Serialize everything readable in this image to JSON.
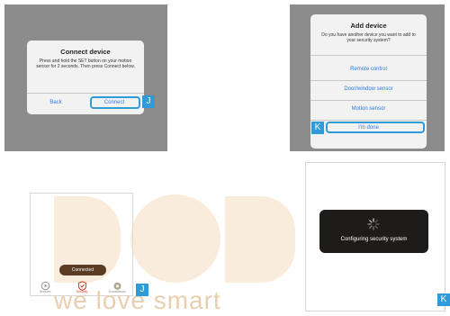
{
  "connect_dialog": {
    "title": "Connect device",
    "body": "Press and hold the SET button on your motion sensor for 2 seconds. Then press Connect below.",
    "back_label": "Back",
    "connect_label": "Connect",
    "marker": "J"
  },
  "add_dialog": {
    "title": "Add device",
    "body": "Do you have another device you want to add to your security system?",
    "options": [
      "Remote control",
      "Door/window sensor",
      "Motion sensor",
      "I'm done"
    ],
    "marker": "K"
  },
  "app_screen": {
    "toast": "Connected",
    "tabs": [
      "Sensors",
      "Security",
      "Surveillance"
    ],
    "marker": "J"
  },
  "config_screen": {
    "status": "Configuring security system",
    "marker": "K"
  },
  "watermark": {
    "text": "we love smart"
  },
  "colors": {
    "accent_blue": "#2f9bd9",
    "link_blue": "#2c7be5",
    "security_red": "#e0301e"
  }
}
